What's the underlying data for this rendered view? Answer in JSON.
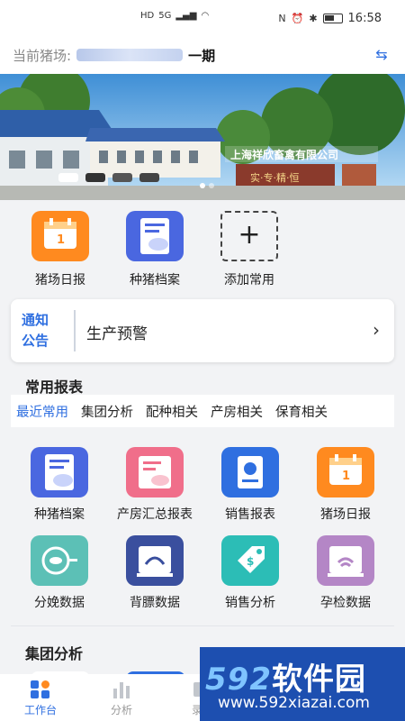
{
  "status_bar": {
    "left_icons": [
      "HD",
      "5G",
      "signal",
      "wifi"
    ],
    "right_icons": [
      "nfc-icon",
      "alarm-icon",
      "bluetooth-icon",
      "battery-icon"
    ],
    "time": "16:58"
  },
  "farm": {
    "label": "当前猪场:",
    "name_suffix": "一期"
  },
  "quick_actions": [
    {
      "label": "猪场日报",
      "icon": "calendar-icon",
      "color": "#ff8a1f"
    },
    {
      "label": "种猪档案",
      "icon": "pig-file-icon",
      "color": "#4a67e0"
    },
    {
      "label": "添加常用",
      "icon": "plus-icon"
    }
  ],
  "notice": {
    "tag_line1": "通知",
    "tag_line2": "公告",
    "text": "生产预警"
  },
  "reports": {
    "title": "常用报表",
    "tabs": [
      "最近常用",
      "集团分析",
      "配种相关",
      "产房相关",
      "保育相关"
    ],
    "active_tab": 0,
    "items": [
      {
        "label": "种猪档案",
        "icon": "pig-file-icon",
        "color": "#4a67e0"
      },
      {
        "label": "产房汇总报表",
        "icon": "farrowing-report-icon",
        "color": "#f06e8a"
      },
      {
        "label": "销售报表",
        "icon": "sales-report-icon",
        "color": "#2f6fe0"
      },
      {
        "label": "猪场日报",
        "icon": "calendar-icon",
        "color": "#ff8a1f"
      },
      {
        "label": "分娩数据",
        "icon": "delivery-icon",
        "color": "#5cc0b6"
      },
      {
        "label": "背膘数据",
        "icon": "backfat-icon",
        "color": "#3a4f9e"
      },
      {
        "label": "销售分析",
        "icon": "price-tag-icon",
        "color": "#2cbdb6"
      },
      {
        "label": "孕检数据",
        "icon": "ultrasound-icon",
        "color": "#b486c6"
      }
    ]
  },
  "group_section": {
    "title": "集团分析"
  },
  "bottom_nav": [
    {
      "label": "工作台",
      "icon": "workbench-icon"
    },
    {
      "label": "分析",
      "icon": "bar-chart-icon"
    },
    {
      "label": "录入",
      "icon": "entry-icon"
    }
  ],
  "watermark": {
    "line1_a": "592",
    "line1_b": "软件园",
    "line2": "www.592xiazai.com"
  },
  "banner": {
    "sign_text": "上海祥欣畜禽有限公司",
    "motto": "实·专·精·恒"
  }
}
